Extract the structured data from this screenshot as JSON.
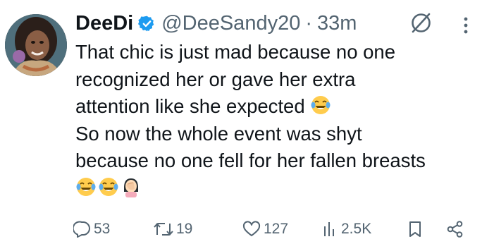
{
  "tweet": {
    "author": {
      "display_name": "DeeDi",
      "handle": "@DeeSandy20",
      "separator": "·",
      "time": "33m",
      "verified": true
    },
    "text_lines": [
      "That chic is just mad because no one",
      "recognized her or gave her extra",
      "attention like she expected",
      "So now the whole event was shyt",
      "because no one fell for her fallen breasts"
    ],
    "emojis": {
      "line3": [
        "face-with-tears-of-joy"
      ],
      "line6": [
        "face-with-tears-of-joy",
        "face-with-tears-of-joy",
        "woman-facepalming"
      ]
    },
    "metrics": {
      "replies": "53",
      "reposts": "19",
      "likes": "127",
      "views": "2.5K"
    },
    "icons": {
      "grok": "grok-icon",
      "more": "more-icon",
      "reply": "reply-icon",
      "repost": "repost-icon",
      "like": "like-icon",
      "views": "views-icon",
      "bookmark": "bookmark-icon",
      "share": "share-icon"
    },
    "colors": {
      "text": "#0f1419",
      "secondary": "#536471",
      "verified": "#1d9bf0"
    }
  }
}
